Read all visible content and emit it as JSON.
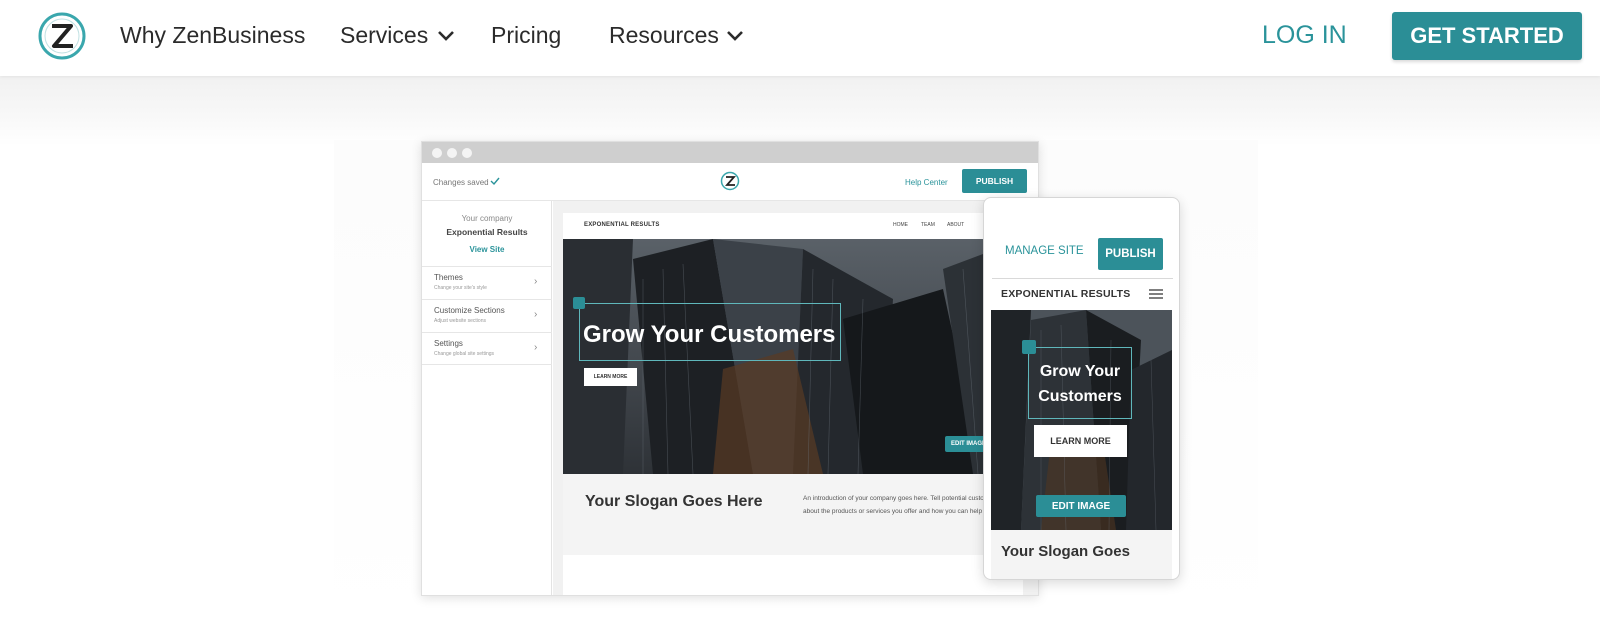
{
  "nav": {
    "links": [
      "Why ZenBusiness",
      "Services",
      "Pricing",
      "Resources"
    ],
    "login": "LOG IN",
    "cta": "GET STARTED"
  },
  "desktop_mock": {
    "status": "Changes saved",
    "help": "Help Center",
    "publish": "PUBLISH",
    "company_label": "Your company",
    "company_name": "Exponential Results",
    "view_site": "View Site",
    "sidebar_items": [
      {
        "title": "Themes",
        "sub": "Change your site's style"
      },
      {
        "title": "Customize Sections",
        "sub": "Adjust website sections"
      },
      {
        "title": "Settings",
        "sub": "Change global site settings"
      }
    ],
    "site_brand": "EXPONENTIAL RESULTS",
    "site_nav": [
      "HOME",
      "TEAM",
      "ABOUT"
    ],
    "hero_title": "Grow Your Customers",
    "learn_more": "LEARN MORE",
    "edit_image": "EDIT IMAGE",
    "slogan": "Your Slogan Goes Here",
    "intro": "An introduction of your company goes here. Tell potential customers about the products or services you offer and how you can help them."
  },
  "mobile_mock": {
    "manage": "MANAGE SITE",
    "publish": "PUBLISH",
    "brand": "EXPONENTIAL RESULTS",
    "hero_title": "Grow Your Customers",
    "learn_more": "LEARN MORE",
    "edit_image": "EDIT IMAGE",
    "slogan": "Your Slogan Goes"
  },
  "colors": {
    "brand_teal": "#2b8e96",
    "link_teal": "#2a939a",
    "text_dark": "#2b2b2b"
  },
  "icons": [
    "zenbusiness-logo-icon",
    "chevron-down-icon",
    "check-icon",
    "pencil-icon",
    "hamburger-menu-icon"
  ]
}
